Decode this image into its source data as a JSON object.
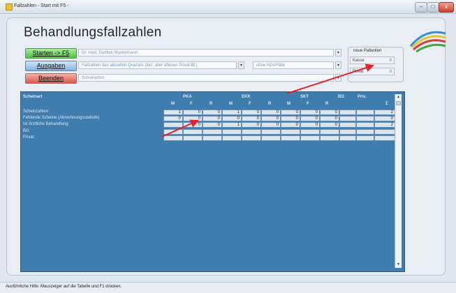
{
  "window": {
    "title": "Fallzahlen - Start mit F5 -",
    "minimize": "–",
    "maximize": "□",
    "close": "x"
  },
  "page": {
    "heading": "Behandlungsfallzahlen"
  },
  "buttons": {
    "start": "Starten -> F5",
    "output": "Ausgaben",
    "end": "Beenden"
  },
  "fields": {
    "doctor": "Dr. med. Gottlieb Mustermann",
    "option1": "Fallzahlen des aktuellen Quartals (incl. aller offenen Privat-Bl.)",
    "option2": "ohne HzV-Fälle",
    "schedule": "Scheinarten"
  },
  "new_patients": {
    "title": "neue Patienten",
    "kasse_label": "Kasse",
    "kasse_value": "0",
    "privat_label": "Privat",
    "privat_value": "0"
  },
  "table": {
    "col_label": "Scheinart",
    "groups": [
      "PKA",
      "EKK",
      "SKT",
      "BG",
      "Priv."
    ],
    "sub": [
      "M",
      "F",
      "R",
      "M",
      "F",
      "R",
      "M",
      "F",
      "R",
      "Σ"
    ],
    "rows": [
      {
        "label": "Scheinzahlen",
        "values": [
          "1",
          "0",
          "0",
          "1",
          "0",
          "0",
          "0",
          "0",
          "0",
          "",
          "",
          "2"
        ]
      },
      {
        "label": "Fehlende Scheine (Abrechnungsstatistik)",
        "values": [
          "0",
          "0",
          "0",
          "0",
          "0",
          "0",
          "0",
          "0",
          "0",
          "",
          "",
          "0"
        ]
      },
      {
        "label": "Ist Ärztliche Behandlung",
        "values": [
          "",
          "0",
          "0",
          "1",
          "0",
          "0",
          "0",
          "0",
          "0",
          "",
          "",
          "2"
        ]
      },
      {
        "label": "BG",
        "values": [
          "",
          "",
          "",
          "",
          "",
          "",
          "",
          "",
          "",
          "",
          "",
          ""
        ]
      },
      {
        "label": "Privat",
        "values": [
          "",
          "",
          "",
          "",
          "",
          "",
          "",
          "",
          "",
          "",
          "",
          ""
        ]
      }
    ]
  },
  "status": "Ausführliche Hilfe: Mauszeiger auf die Tabelle und F1 drücken.",
  "colors": {
    "arrow": "#e8202a",
    "grid_bg": "#3f7daf"
  }
}
